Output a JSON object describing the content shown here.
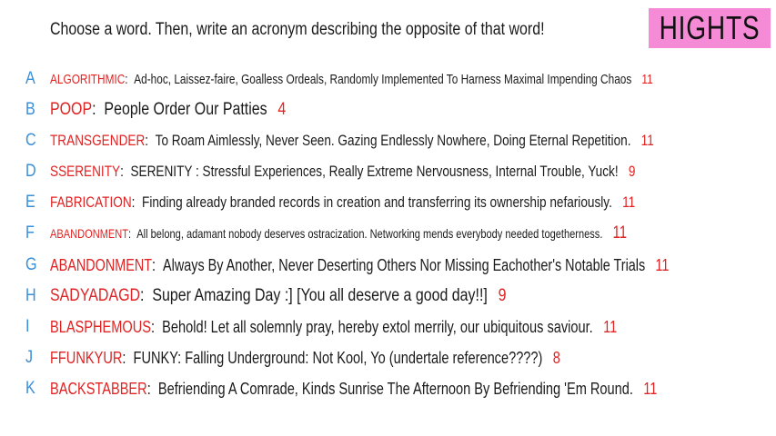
{
  "header": {
    "prompt": "Choose a word. Then, write an acronym describing the opposite of that word!",
    "badge": "HIGHTS"
  },
  "colors": {
    "letter": "#3a8fd9",
    "word": "#e02323",
    "badge_bg": "#f58ad6"
  },
  "entries": [
    {
      "letter": "A",
      "word": "ALGORITHMIC",
      "sep": ":",
      "text": "Ad-hoc, Laissez-faire, Goalless Ordeals, Randomly Implemented To Harness Maximal Impending Chaos",
      "count": "11"
    },
    {
      "letter": "B",
      "word": "POOP",
      "sep": ":",
      "text": "People Order Our Patties",
      "count": "4"
    },
    {
      "letter": "C",
      "word": "TRANSGENDER",
      "sep": ":",
      "text": "To Roam Aimlessly, Never Seen. Gazing Endlessly Nowhere, Doing Eternal Repetition.",
      "count": "11"
    },
    {
      "letter": "D",
      "word": "SSERENITY",
      "sep": ":",
      "text": "SERENITY : Stressful Experiences, Really Extreme Nervousness, Internal Trouble, Yuck!",
      "count": "9"
    },
    {
      "letter": "E",
      "word": "FABRICATION",
      "sep": ":",
      "text": "Finding already branded records in creation and transferring its ownership nefariously.",
      "count": "11"
    },
    {
      "letter": "F",
      "word": "ABANDONMENT",
      "sep": ":",
      "text": "All belong, adamant nobody deserves ostracization.  Networking mends everybody needed togetherness.",
      "count": "11"
    },
    {
      "letter": "G",
      "word": "ABANDONMENT",
      "sep": ":",
      "text": "Always By Another, Never Deserting Others Nor Missing Eachother's Notable Trials",
      "count": "11"
    },
    {
      "letter": "H",
      "word": "SADYADAGD",
      "sep": ":",
      "text": "Super Amazing Day :] [You all deserve a good day!!]",
      "count": "9"
    },
    {
      "letter": "I",
      "word": "BLASPHEMOUS",
      "sep": ":",
      "text": "Behold! Let all solemnly pray, hereby extol merrily, our ubiquitous saviour.",
      "count": "11"
    },
    {
      "letter": "J",
      "word": "FFUNKYUR",
      "sep": ":",
      "text": "FUNKY: Falling Underground: Not Kool, Yo (undertale reference????)",
      "count": "8"
    },
    {
      "letter": "K",
      "word": "BACKSTABBER",
      "sep": ":",
      "text": "Befriending A Comrade, Kinds Sunrise The Afternoon By Befriending 'Em Round.",
      "count": "11"
    }
  ]
}
